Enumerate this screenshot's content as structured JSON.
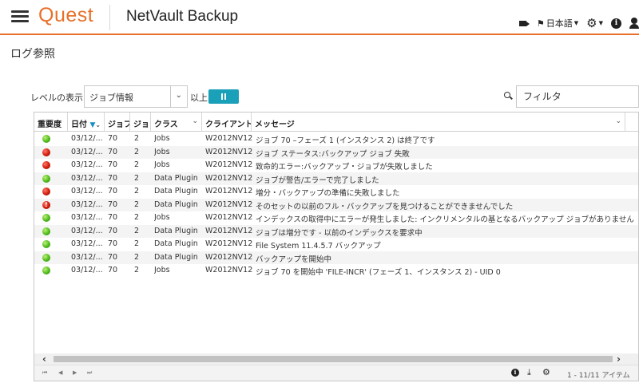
{
  "header": {
    "logo": "Quest",
    "app_title": "NetVault Backup",
    "language": "日本語"
  },
  "page": {
    "title": "ログ参照"
  },
  "toolbar": {
    "level_label": "レベルの表示",
    "level_value": "ジョブ情報",
    "above_label": "以上",
    "filter_placeholder": "フィルタ"
  },
  "grid": {
    "columns": [
      "重要度",
      "日付",
      "ジョブ",
      "ジョブ",
      "クラス",
      "クライアント",
      "メッセージ"
    ],
    "rows": [
      {
        "severity": "green",
        "date": "03/12/...",
        "job": "70",
        "instance": "2",
        "class": "Jobs",
        "client": "W2012NV12",
        "message": "ジョブ 70 –フェーズ 1 (インスタンス 2) は終了です"
      },
      {
        "severity": "red",
        "date": "03/12/...",
        "job": "70",
        "instance": "2",
        "class": "Jobs",
        "client": "W2012NV12",
        "message": "ジョブ ステータス:バックアップ ジョブ 失敗"
      },
      {
        "severity": "red",
        "date": "03/12/...",
        "job": "70",
        "instance": "2",
        "class": "Jobs",
        "client": "W2012NV12",
        "message": "致命的エラー:バックアップ・ジョブが失敗しました"
      },
      {
        "severity": "green",
        "date": "03/12/...",
        "job": "70",
        "instance": "2",
        "class": "Data Plugin",
        "client": "W2012NV12",
        "message": "ジョブが警告/エラーで完了しました"
      },
      {
        "severity": "red",
        "date": "03/12/...",
        "job": "70",
        "instance": "2",
        "class": "Data Plugin",
        "client": "W2012NV12",
        "message": "増分・バックアップの準備に失敗しました"
      },
      {
        "severity": "warn",
        "date": "03/12/...",
        "job": "70",
        "instance": "2",
        "class": "Data Plugin",
        "client": "W2012NV12",
        "message": "そのセットの以前のフル・バックアップを見つけることができませんでした"
      },
      {
        "severity": "green",
        "date": "03/12/...",
        "job": "70",
        "instance": "2",
        "class": "Jobs",
        "client": "W2012NV12",
        "message": "インデックスの取得中にエラーが発生しました: インクリメンタルの基となるバックアップ ジョブがありません"
      },
      {
        "severity": "green",
        "date": "03/12/...",
        "job": "70",
        "instance": "2",
        "class": "Data Plugin",
        "client": "W2012NV12",
        "message": "ジョブは増分です - 以前のインデックスを要求中"
      },
      {
        "severity": "green",
        "date": "03/12/...",
        "job": "70",
        "instance": "2",
        "class": "Data Plugin",
        "client": "W2012NV12",
        "message": "File System 11.4.5.7 バックアップ"
      },
      {
        "severity": "green",
        "date": "03/12/...",
        "job": "70",
        "instance": "2",
        "class": "Data Plugin",
        "client": "W2012NV12",
        "message": "バックアップを開始中"
      },
      {
        "severity": "green",
        "date": "03/12/...",
        "job": "70",
        "instance": "2",
        "class": "Jobs",
        "client": "W2012NV12",
        "message": "ジョブ 70 を開始中 'FILE-INCR' (フェーズ 1、インスタンス 2) - UID 0"
      }
    ],
    "footer_count": "1 - 11/11 アイテム"
  },
  "colors": {
    "accent": "#e8702a",
    "button": "#1aa0b8"
  }
}
